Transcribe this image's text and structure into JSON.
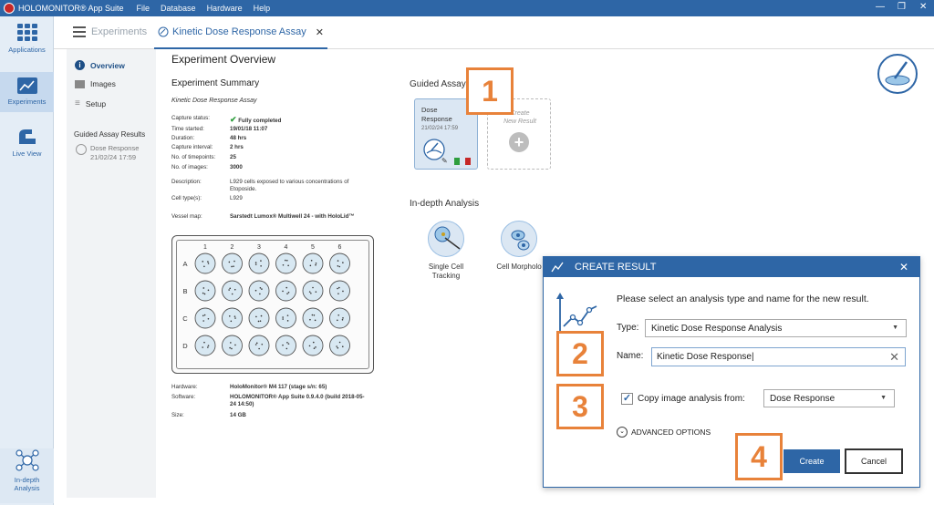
{
  "titlebar": {
    "app_title": "HOLOMONITOR® App Suite",
    "menu": [
      "File",
      "Database",
      "Hardware",
      "Help"
    ]
  },
  "rail": {
    "applications": "Applications",
    "experiments": "Experiments",
    "live_view": "Live View",
    "indepth": "In-depth\nAnalysis"
  },
  "tabs": {
    "experiments": "Experiments",
    "active": "Kinetic Dose Response Assay"
  },
  "leftpanel": {
    "overview": "Overview",
    "images": "Images",
    "setup": "Setup",
    "section": "Guided Assay Results",
    "result_name": "Dose Response",
    "result_date": "21/02/24 17:59"
  },
  "overview": {
    "title": "Experiment Overview",
    "summary": "Experiment Summary",
    "assay_name": "Kinetic Dose Response Assay",
    "fields": {
      "capture_status_k": "Capture status:",
      "capture_status_v": "Fully completed",
      "time_started_k": "Time started:",
      "time_started_v": "19/01/18 11:07",
      "duration_k": "Duration:",
      "duration_v": "48 hrs",
      "capture_interval_k": "Capture interval:",
      "capture_interval_v": "2 hrs",
      "timepoints_k": "No. of timepoints:",
      "timepoints_v": "25",
      "images_k": "No. of images:",
      "images_v": "3000",
      "description_k": "Description:",
      "description_v": "L929 cells exposed to various concentrations of Etoposide.",
      "cell_types_k": "Cell type(s):",
      "cell_types_v": "L929",
      "vessel_map_k": "Vessel map:",
      "vessel_map_v": "Sarstedt Lumox® Multiwell 24 - with HoloLid™",
      "hardware_k": "Hardware:",
      "hardware_v": "HoloMonitor® M4 117 (stage s/n: 65)",
      "software_k": "Software:",
      "software_v": "HOLOMONITOR® App Suite 0.9.4.0 (build 2018-05-24 14:50)",
      "size_k": "Size:",
      "size_v": "14 GB"
    },
    "plate_cols": [
      "1",
      "2",
      "3",
      "4",
      "5",
      "6"
    ],
    "plate_rows": [
      "A",
      "B",
      "C",
      "D"
    ]
  },
  "guided": {
    "title": "Guided Assay",
    "card_name": "Dose\nResponse",
    "card_date": "21/02/24 17:59",
    "create_label": "Create\nNew Result"
  },
  "indepth": {
    "title": "In-depth Analysis",
    "single_cell": "Single Cell\nTracking",
    "cell_morph": "Cell Morpholo"
  },
  "dialog": {
    "title": "CREATE RESULT",
    "prompt": "Please select an analysis type and name for the new result.",
    "type_label": "Type:",
    "type_value": "Kinetic Dose Response Analysis",
    "name_label": "Name:",
    "name_value": "Kinetic Dose Response",
    "copy_label": "Copy image analysis from:",
    "copy_value": "Dose Response",
    "advanced": "ADVANCED OPTIONS",
    "create": "Create",
    "cancel": "Cancel"
  },
  "steps": [
    "1",
    "2",
    "3",
    "4"
  ],
  "colors": {
    "accent": "#2e66a6",
    "step_orange": "#e8823a",
    "success_green": "#2e9e3e"
  }
}
